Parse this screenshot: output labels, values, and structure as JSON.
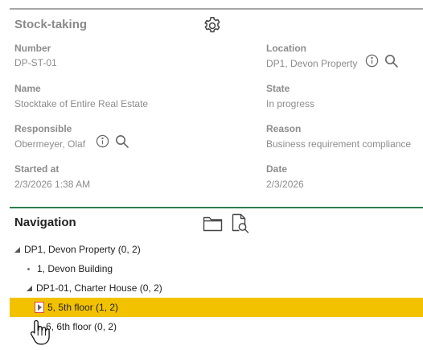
{
  "stock": {
    "title": "Stock-taking",
    "settings_icon": "gear-icon",
    "fields": {
      "number": {
        "label": "Number",
        "value": "DP-ST-01"
      },
      "location": {
        "label": "Location",
        "value": "DP1, Devon Property"
      },
      "name": {
        "label": "Name",
        "value": "Stocktake of Entire Real Estate"
      },
      "state": {
        "label": "State",
        "value": "In progress"
      },
      "responsible": {
        "label": "Responsible",
        "value": "Obermeyer, Olaf"
      },
      "reason": {
        "label": "Reason",
        "value": "Business requirement compliance"
      },
      "started_at": {
        "label": "Started at",
        "value": "2/3/2026 1:38 AM"
      },
      "date": {
        "label": "Date",
        "value": "2/3/2026"
      }
    }
  },
  "navigation": {
    "title": "Navigation",
    "tree": [
      {
        "label": "DP1, Devon Property (0, 2)",
        "expanded": true,
        "level": 0
      },
      {
        "label": "1, Devon Building",
        "leaf": true,
        "level": 1
      },
      {
        "label": "DP1-01, Charter House (0, 2)",
        "expanded": true,
        "level": 1
      },
      {
        "label": "5, 5th floor (1, 2)",
        "expanded": false,
        "selected": true,
        "level": 2
      },
      {
        "label": "6, 6th floor (0, 2)",
        "expanded": false,
        "level": 2
      }
    ]
  },
  "colors": {
    "selected_row": "#f2c200",
    "section_divider": "#2e7d4f",
    "expander_highlight": "#e0463c"
  }
}
